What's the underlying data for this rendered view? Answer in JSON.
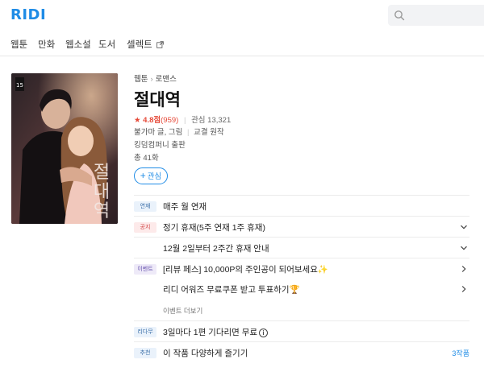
{
  "header": {
    "logo": "RIDI",
    "search_placeholder": ""
  },
  "nav": {
    "items": [
      "웹툰",
      "만화",
      "웹소설",
      "도서",
      "셀렉트"
    ]
  },
  "book": {
    "breadcrumb": [
      "웹툰",
      "로맨스"
    ],
    "title": "절대역",
    "rating_star": "★",
    "rating_score": "4.8점",
    "rating_count": "(959)",
    "interest": "관심 13,321",
    "authors": "불가마 글, 그림",
    "original": "교결 원작",
    "publisher": "킹덤컴퍼니 출판",
    "episodes": "총 41화",
    "follow_label": "관심",
    "cover_title_chars": [
      "절",
      "대",
      "역"
    ]
  },
  "info_rows": [
    {
      "badge": "연재",
      "badge_color": "blue",
      "text": "매주 월 연재",
      "action": ""
    },
    {
      "badge": "공지",
      "badge_color": "red",
      "text": "정기 휴재(5주 연재 1주 휴재)",
      "action": "chevron-down"
    },
    {
      "badge": "",
      "badge_color": "",
      "text": "12월 2일부터 2주간 휴재 안내",
      "action": "chevron-down"
    },
    {
      "badge": "이벤트",
      "badge_color": "purple",
      "text": "[리뷰 페스] 10,000P의 주인공이 되어보세요✨",
      "action": "chevron-right"
    },
    {
      "badge": "",
      "badge_color": "",
      "text": "리디 어워즈 무료쿠폰 받고 투표하기🏆",
      "action": "chevron-right"
    },
    {
      "badge": "",
      "badge_color": "",
      "text": "이벤트 더보기",
      "action": ""
    },
    {
      "badge": "리다무",
      "badge_color": "blue",
      "text": "3일마다 1편 기다리면 무료",
      "action": "info"
    },
    {
      "badge": "추천",
      "badge_color": "blue",
      "text": "이 작품 다양하게 즐기기",
      "action": "link",
      "link_text": "3작품"
    }
  ],
  "colors": {
    "brand": "#1f8ce6",
    "star": "#e64938"
  }
}
